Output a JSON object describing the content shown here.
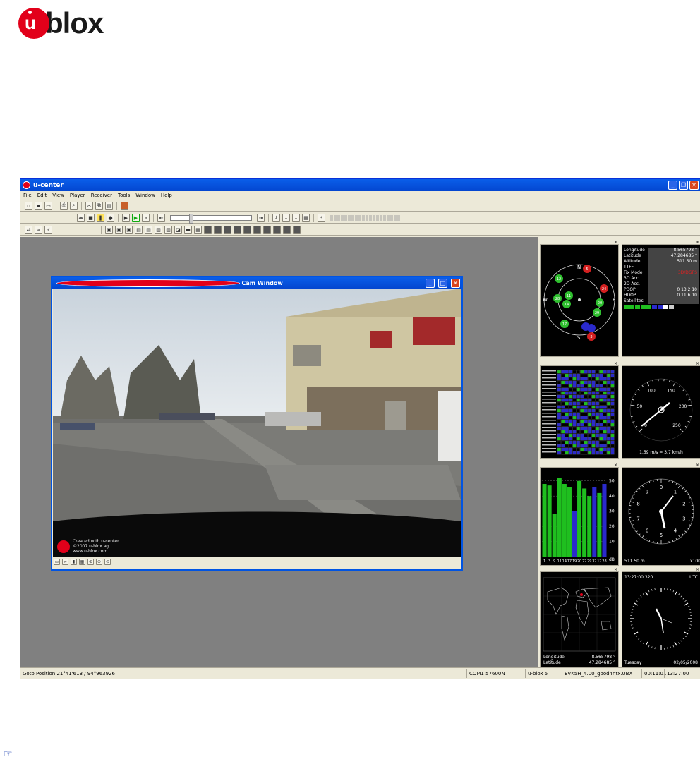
{
  "logo": {
    "text": "blox",
    "u": "u"
  },
  "app": {
    "title": "u-center",
    "menu": [
      "File",
      "Edit",
      "View",
      "Player",
      "Receiver",
      "Tools",
      "Window",
      "Help"
    ]
  },
  "cam_window": {
    "title": "Cam Window",
    "watermark": [
      "Created with u-center",
      "©2007 u-blox ag",
      "www.u-blox.com"
    ]
  },
  "position_panel": {
    "rows": [
      {
        "label": "Longitude",
        "value": "8.565798 °"
      },
      {
        "label": "Latitude",
        "value": "47.284685 °"
      },
      {
        "label": "Altitude",
        "value": "511.50 m"
      },
      {
        "label": "TTFF",
        "value": ""
      },
      {
        "label": "Fix Mode",
        "value": "3D/DGPS"
      },
      {
        "label": "3D Acc.",
        "value": ""
      },
      {
        "label": "2D Acc.",
        "value": ""
      },
      {
        "label": "PDOP",
        "value": "0      13.2      10"
      },
      {
        "label": "HDOP",
        "value": "0      11.6      10"
      },
      {
        "label": "Satellites",
        "value": ""
      }
    ]
  },
  "sky_view": {
    "directions": [
      "N",
      "E",
      "S",
      "W"
    ],
    "satellites_green": [
      "12",
      "28",
      "11",
      "14",
      "17",
      "20",
      "29"
    ],
    "satellites_red": [
      "5",
      "24",
      "3"
    ]
  },
  "speedometer": {
    "ticks": [
      "0",
      "50",
      "100",
      "150",
      "200",
      "250"
    ],
    "readout": "1.59 m/s = 3.7 km/h",
    "speed_fraction": 0.02
  },
  "altimeter": {
    "ticks": [
      "0",
      "1",
      "2",
      "3",
      "4",
      "5",
      "6",
      "7",
      "8",
      "9"
    ],
    "readout": "511.50 m",
    "unit": "x100"
  },
  "clock": {
    "time": "13:27:00.320",
    "zone": "UTC",
    "day": "Tuesday",
    "date": "02/05/2008"
  },
  "world_map": {
    "longitude_label": "Longitude",
    "longitude": "8.565798 °",
    "latitude_label": "Latitude",
    "latitude": "47.284685 °"
  },
  "signal_chart": {
    "type": "bar",
    "yticks": [
      "50",
      "40",
      "30",
      "20",
      "10",
      "dB"
    ],
    "categories": [
      "1",
      "3",
      "9",
      "11",
      "14",
      "17",
      "19",
      "20",
      "22",
      "29",
      "32",
      "12",
      "28"
    ],
    "values": [
      48,
      47,
      28,
      52,
      48,
      46,
      30,
      50,
      45,
      40,
      46,
      42,
      48
    ],
    "colors": [
      "green",
      "green",
      "green",
      "green",
      "green",
      "green",
      "blue",
      "green",
      "green",
      "green",
      "blue",
      "green",
      "blue"
    ],
    "ylim": [
      0,
      55
    ]
  },
  "statusbar": {
    "goto": "Goto Position 21°41'613 / 94°963926",
    "port": "COM1 57600N",
    "receiver": "u-blox 5",
    "file": "EVK5H_4.00_good4ntx.UBX",
    "elapsed": "00:11:01",
    "time": "13:27:00"
  },
  "colors": {
    "accent": "#e2001a",
    "xp_title": "#0346d0",
    "workspace": "#808080"
  },
  "footer_icon": "pointing-hand-icon"
}
